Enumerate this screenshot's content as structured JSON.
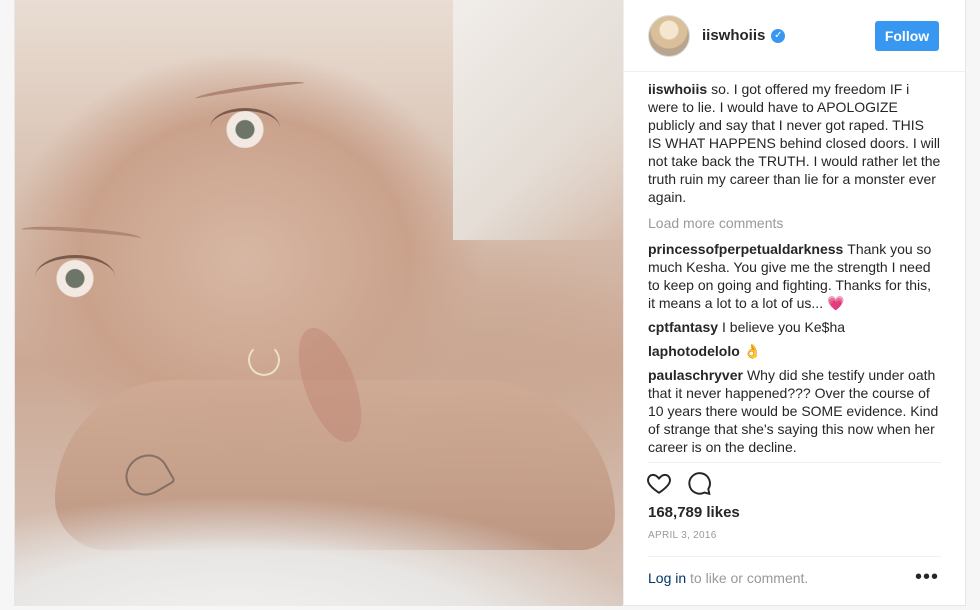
{
  "profile": {
    "username": "iiswhoiis",
    "follow_label": "Follow"
  },
  "caption": {
    "user": "iiswhoiis",
    "text": "so. I got offered my freedom IF i were to lie. I would have to APOLOGIZE publicly and say that I never got raped. THIS IS WHAT HAPPENS behind closed doors. I will not take back the TRUTH. I would rather let the truth ruin my career than lie for a monster ever again."
  },
  "load_more": "Load more comments",
  "comments": [
    {
      "user": "princessofperpetualdarkness",
      "text": "Thank you so much Kesha. You give me the strength I need to keep on going and fighting. Thanks for this, it means a lot to a lot of us... 💗"
    },
    {
      "user": "cptfantasy",
      "text": "I believe you Ke$ha"
    },
    {
      "user": "laphotodelolo",
      "text": "👌"
    },
    {
      "user": "paulaschryver",
      "text": "Why did she testify under oath that it never happened??? Over the course of 10 years there would be SOME evidence. Kind of strange that she's saying this now when her career is on the decline."
    }
  ],
  "likes": "168,789 likes",
  "date": "APRIL 3, 2016",
  "login": {
    "link": "Log in",
    "rest": "to like or comment."
  },
  "more_glyph": "•••",
  "icons": [
    "heart-icon",
    "comment-icon",
    "verified-badge-icon",
    "more-options-icon"
  ],
  "colors": {
    "accent": "#3897f0",
    "muted": "#999999",
    "link": "#003569"
  }
}
